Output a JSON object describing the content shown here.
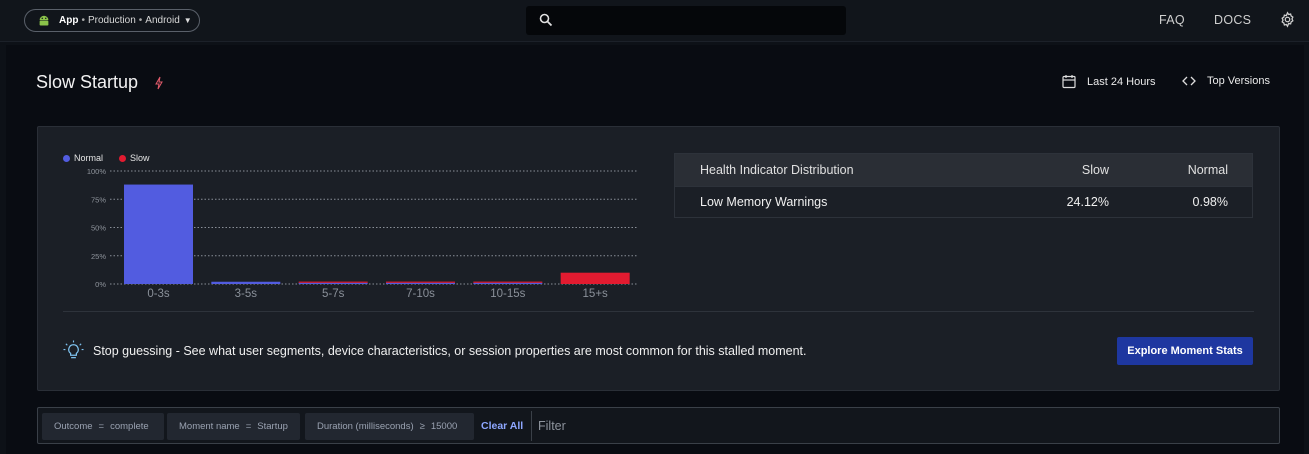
{
  "topbar": {
    "app_name": "App",
    "environment": "Production",
    "platform": "Android",
    "separator": "•",
    "search_placeholder": "",
    "faq_label": "FAQ",
    "docs_label": "DOCS",
    "icons": [
      "android-icon",
      "caret-down-icon",
      "search-icon",
      "gear-icon"
    ]
  },
  "page": {
    "title": "Slow Startup",
    "date_range_label": "Last 24 Hours",
    "versions_label": "Top Versions"
  },
  "chart_data": {
    "type": "bar",
    "categories": [
      "0-3s",
      "3-5s",
      "5-7s",
      "7-10s",
      "10-15s",
      "15+s"
    ],
    "series": [
      {
        "name": "Normal",
        "color": "#525ce0",
        "values": [
          88,
          2,
          0.5,
          0.3,
          0.3,
          0
        ]
      },
      {
        "name": "Slow",
        "color": "#e21b30",
        "values": [
          0,
          0,
          0.5,
          0.5,
          0.5,
          10
        ]
      }
    ],
    "y_ticks": [
      "0%",
      "25%",
      "50%",
      "75%",
      "100%"
    ],
    "ylim": [
      0,
      100
    ],
    "grid": true,
    "legend_position": "top-left"
  },
  "health_table": {
    "headers": [
      "Health Indicator Distribution",
      "Slow",
      "Normal"
    ],
    "rows": [
      {
        "name": "Low Memory Warnings",
        "slow": "24.12%",
        "normal": "0.98%"
      }
    ]
  },
  "tip": {
    "text": "Stop guessing - See what user segments, device characteristics, or session properties are most common for this stalled moment.",
    "button_label": "Explore Moment Stats"
  },
  "filters": {
    "chips": [
      {
        "field": "Outcome",
        "op": "=",
        "value": "complete"
      },
      {
        "field": "Moment name",
        "op": "=",
        "value": "Startup"
      },
      {
        "field": "Duration (milliseconds)",
        "op": "≥",
        "value": "15000"
      }
    ],
    "clear_label": "Clear All",
    "filter_placeholder": "Filter"
  }
}
